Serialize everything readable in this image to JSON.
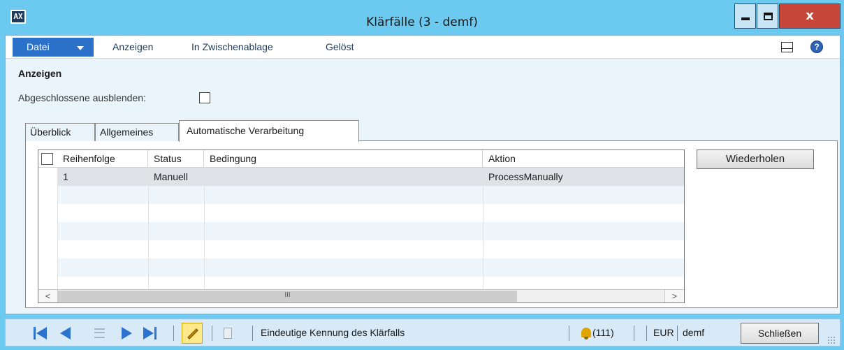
{
  "window": {
    "title": "Klärfälle (3 - demf)",
    "app_icon_text": "AX",
    "close_glyph": "x"
  },
  "menu": {
    "file_label": "Datei",
    "items": [
      "Anzeigen",
      "In Zwischenablage",
      "Gelöst"
    ],
    "help_glyph": "?"
  },
  "filter": {
    "heading": "Anzeigen",
    "hide_closed_label": "Abgeschlossene ausblenden:",
    "hide_closed_checked": false
  },
  "tabs": [
    {
      "label": "Überblick",
      "active": false
    },
    {
      "label": "Allgemeines",
      "active": false
    },
    {
      "label": "Automatische Verarbeitung",
      "active": true
    }
  ],
  "grid": {
    "columns": [
      "Reihenfolge",
      "Status",
      "Bedingung",
      "Aktion"
    ],
    "rows": [
      [
        "1",
        "Manuell",
        "",
        "ProcessManually"
      ]
    ],
    "scroll_thumb_glyph": "III",
    "scroll_left": "<",
    "scroll_right": ">"
  },
  "actions": {
    "retry_label": "Wiederholen"
  },
  "statusbar": {
    "record_label": "Eindeutige Kennung des Klärfalls",
    "notifications": "(111)",
    "currency": "EUR",
    "company": "demf",
    "close_label": "Schließen"
  },
  "colors": {
    "titlebar": "#6ccaf0",
    "file_button": "#2b71c9",
    "nav_arrows": "#2b73cf",
    "close_button": "#c7463a"
  }
}
